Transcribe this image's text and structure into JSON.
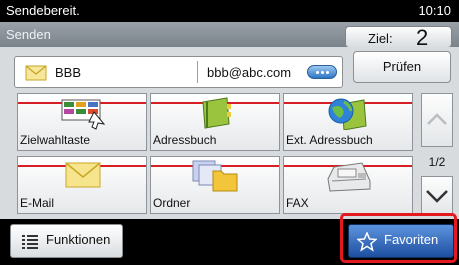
{
  "status": {
    "text": "Sendebereit.",
    "time": "10:10"
  },
  "header": {
    "title": "Senden",
    "dest_label": "Ziel:",
    "dest_count": "2"
  },
  "address": {
    "name": "BBB",
    "email": "bbb@abc.com",
    "check_label": "Prüfen"
  },
  "tiles": [
    {
      "label": "Zielwahltaste",
      "icon": "one-touch-key-icon"
    },
    {
      "label": "Adressbuch",
      "icon": "address-book-icon"
    },
    {
      "label": "Ext. Adressbuch",
      "icon": "external-address-book-icon"
    },
    {
      "label": "E-Mail",
      "icon": "email-envelope-icon"
    },
    {
      "label": "Ordner",
      "icon": "folder-icon"
    },
    {
      "label": "FAX",
      "icon": "fax-icon"
    }
  ],
  "pager": {
    "current": "1/2"
  },
  "footer": {
    "functions_label": "Funktionen",
    "favorites_label": "Favoriten"
  },
  "colors": {
    "accent_red": "#d61f25",
    "highlight_blue": "#1d4fa1",
    "title_bar": "#8a9198"
  }
}
